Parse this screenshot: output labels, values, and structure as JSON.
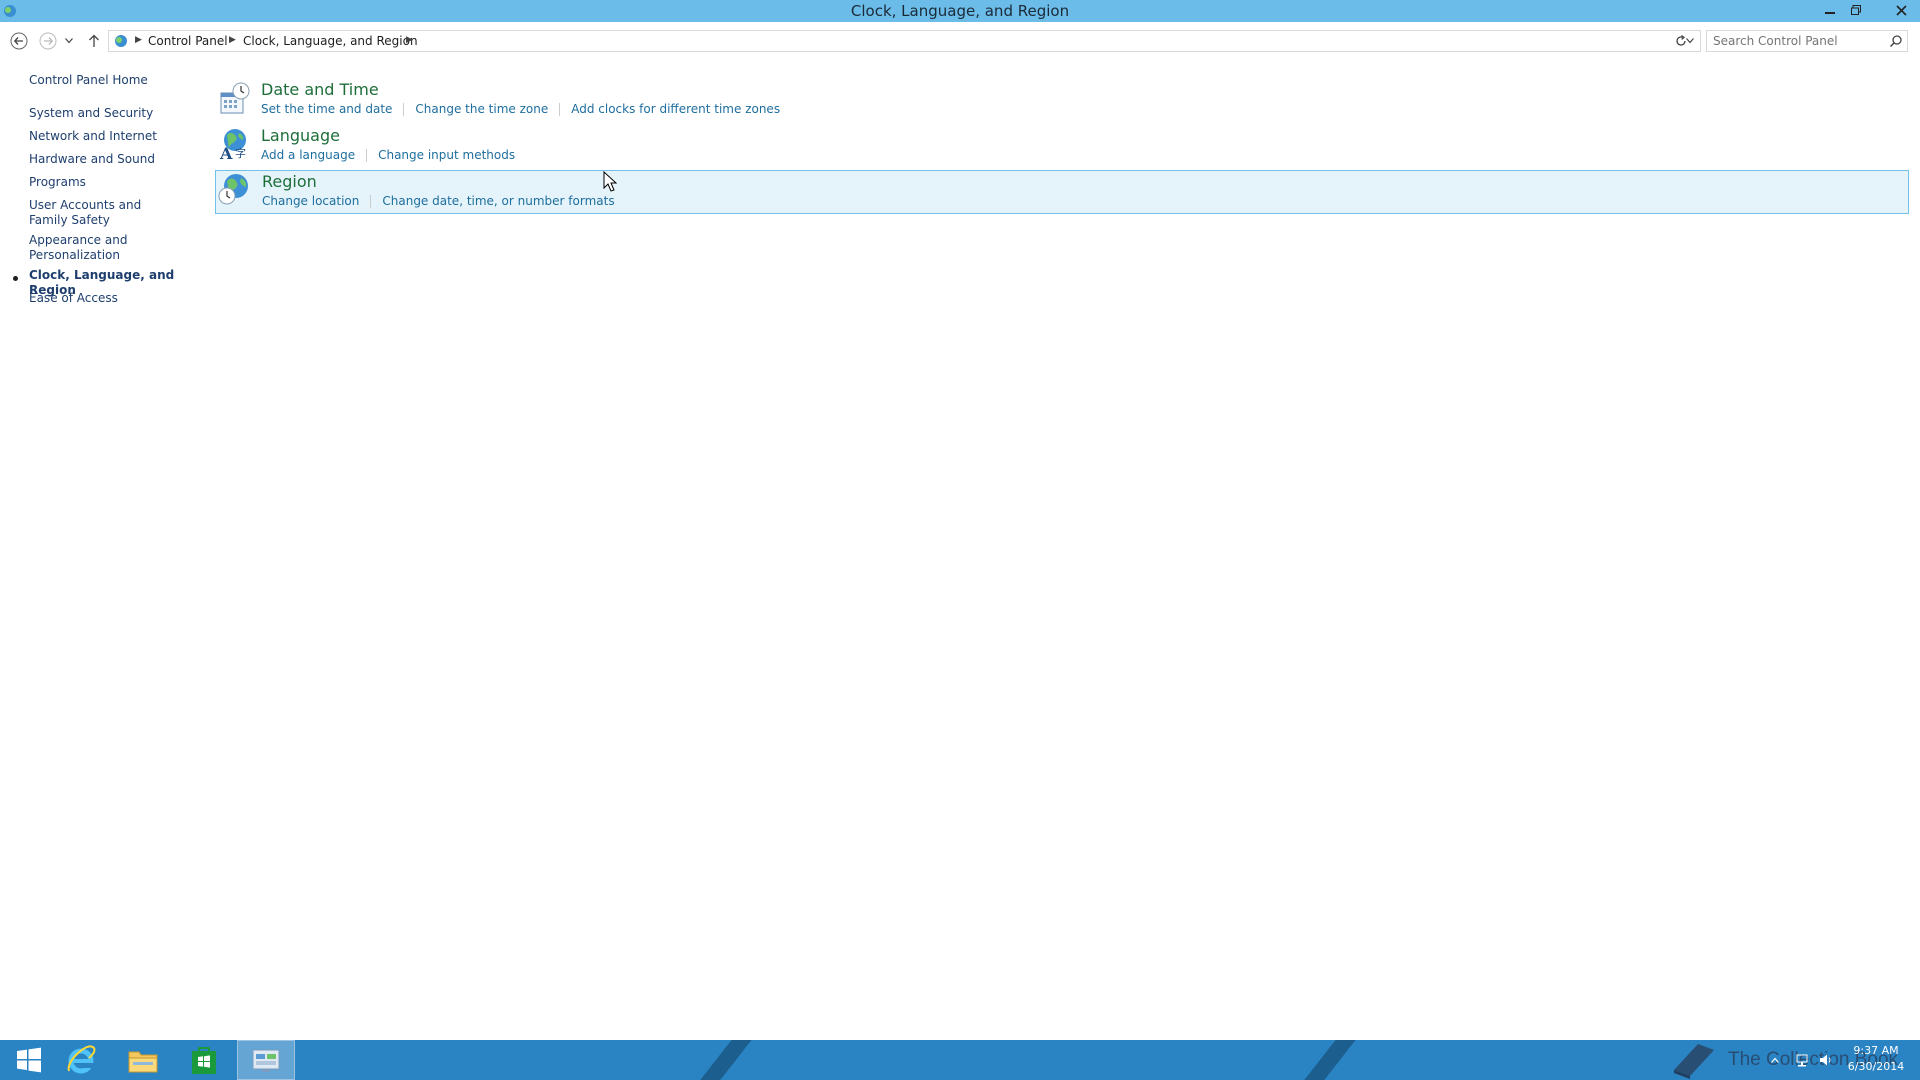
{
  "window": {
    "title": "Clock, Language, and Region"
  },
  "address": {
    "breadcrumbs": [
      "Control Panel",
      "Clock, Language, and Region"
    ],
    "search_placeholder": "Search Control Panel"
  },
  "sidebar": {
    "home": "Control Panel Home",
    "items": [
      {
        "label": "System and Security"
      },
      {
        "label": "Network and Internet"
      },
      {
        "label": "Hardware and Sound"
      },
      {
        "label": "Programs"
      },
      {
        "label": "User Accounts and Family Safety"
      },
      {
        "label": "Appearance and Personalization"
      },
      {
        "label": "Clock, Language, and Region",
        "current": true
      },
      {
        "label": "Ease of Access"
      }
    ]
  },
  "categories": [
    {
      "title": "Date and Time",
      "icon": "calendar-clock-icon",
      "links": [
        "Set the time and date",
        "Change the time zone",
        "Add clocks for different time zones"
      ]
    },
    {
      "title": "Language",
      "icon": "language-globe-icon",
      "links": [
        "Add a language",
        "Change input methods"
      ]
    },
    {
      "title": "Region",
      "icon": "region-globe-icon",
      "links": [
        "Change location",
        "Change date, time, or number formats"
      ]
    }
  ],
  "taskbar": {
    "watermark": "The Collection Book",
    "time": "9:37 AM",
    "date": "6/30/2014"
  },
  "colors": {
    "titlebar": "#6bbce8",
    "taskbar": "#2a83c3",
    "link": "#1e6e9e",
    "category_title": "#1e6e3a",
    "hover_bg": "#e5f3fb"
  }
}
